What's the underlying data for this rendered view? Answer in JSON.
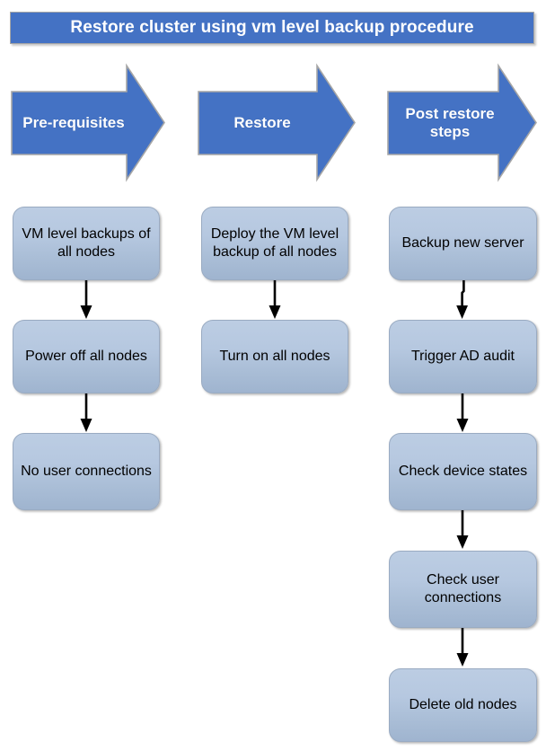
{
  "title": {
    "text": "Restore cluster using vm level backup procedure",
    "background": "#4472C4",
    "color": "#ffffff"
  },
  "theme": {
    "arrow_fill": "#4472C4",
    "arrow_stroke": "#a6a6a6",
    "box_gradient_top": "#bccde3",
    "box_gradient_bottom": "#9fb4cf",
    "box_border": "#9aabc2",
    "connector_color": "#000000",
    "page_background": "#ffffff"
  },
  "stages": [
    {
      "id": "pre-requisites",
      "label": "Pre-requisites",
      "steps": [
        {
          "id": "vm-level-backups",
          "text": "VM level backups of all nodes"
        },
        {
          "id": "power-off-all-nodes",
          "text": "Power off all nodes"
        },
        {
          "id": "no-user-connections",
          "text": "No user connections"
        }
      ]
    },
    {
      "id": "restore",
      "label": "Restore",
      "steps": [
        {
          "id": "deploy-vm-level-backup",
          "text": "Deploy the VM level backup of all nodes"
        },
        {
          "id": "turn-on-all-nodes",
          "text": "Turn on all nodes"
        }
      ]
    },
    {
      "id": "post-restore-steps",
      "label": "Post restore steps",
      "steps": [
        {
          "id": "backup-new-server",
          "text": "Backup new server"
        },
        {
          "id": "trigger-ad-audit",
          "text": "Trigger AD audit"
        },
        {
          "id": "check-device-states",
          "text": "Check device states"
        },
        {
          "id": "check-user-connections",
          "text": "Check user connections"
        },
        {
          "id": "delete-old-nodes",
          "text": "Delete old nodes"
        }
      ]
    }
  ]
}
